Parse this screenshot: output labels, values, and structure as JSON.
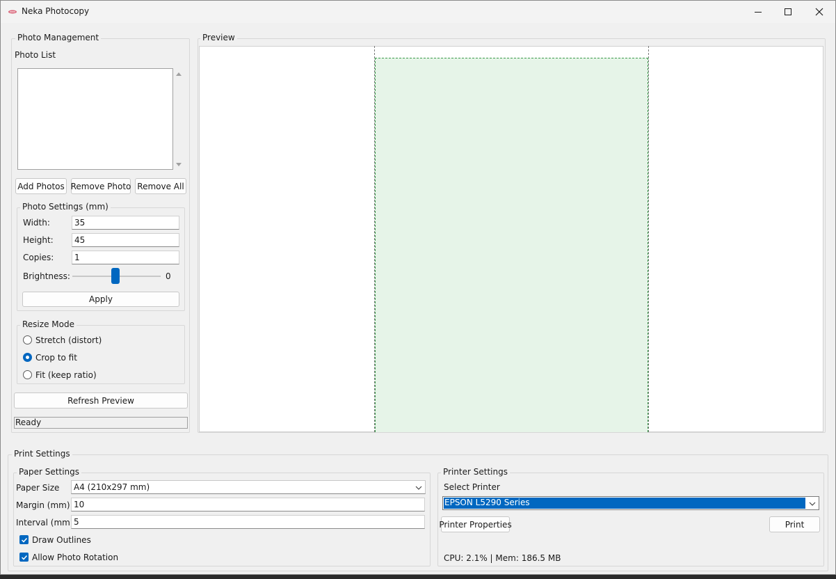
{
  "window": {
    "title": "Neka Photocopy"
  },
  "photo_management": {
    "title": "Photo Management",
    "photo_list_label": "Photo List",
    "buttons": {
      "add": "Add Photos",
      "remove": "Remove Photo",
      "remove_all": "Remove All"
    },
    "photo_settings": {
      "title": "Photo Settings (mm)",
      "width_label": "Width:",
      "width_value": "35",
      "height_label": "Height:",
      "height_value": "45",
      "copies_label": "Copies:",
      "copies_value": "1",
      "brightness_label": "Brightness:",
      "brightness_value": "0",
      "apply_label": "Apply"
    },
    "resize_mode": {
      "title": "Resize Mode",
      "options": [
        "Stretch (distort)",
        "Crop to fit",
        "Fit (keep ratio)"
      ],
      "selected": "Crop to fit"
    },
    "refresh_label": "Refresh Preview",
    "status": "Ready"
  },
  "preview": {
    "title": "Preview"
  },
  "print_settings": {
    "title": "Print Settings",
    "paper": {
      "title": "Paper Settings",
      "size_label": "Paper Size",
      "size_value": "A4 (210x297 mm)",
      "margin_label": "Margin (mm)",
      "margin_value": "10",
      "interval_label": "Interval (mm)",
      "interval_value": "5",
      "draw_outlines_label": "Draw Outlines",
      "draw_outlines_checked": true,
      "allow_rotation_label": "Allow Photo Rotation",
      "allow_rotation_checked": true
    },
    "printer": {
      "title": "Printer Settings",
      "select_label": "Select Printer",
      "selected_printer": "EPSON L5290 Series",
      "properties_label": "Printer Properties",
      "print_label": "Print",
      "sysinfo": "CPU: 2.1% | Mem: 186.5 MB"
    }
  },
  "colors": {
    "accent": "#0067c0",
    "photo_fill": "#e6f4e8",
    "photo_outline": "#3a9a4a"
  }
}
